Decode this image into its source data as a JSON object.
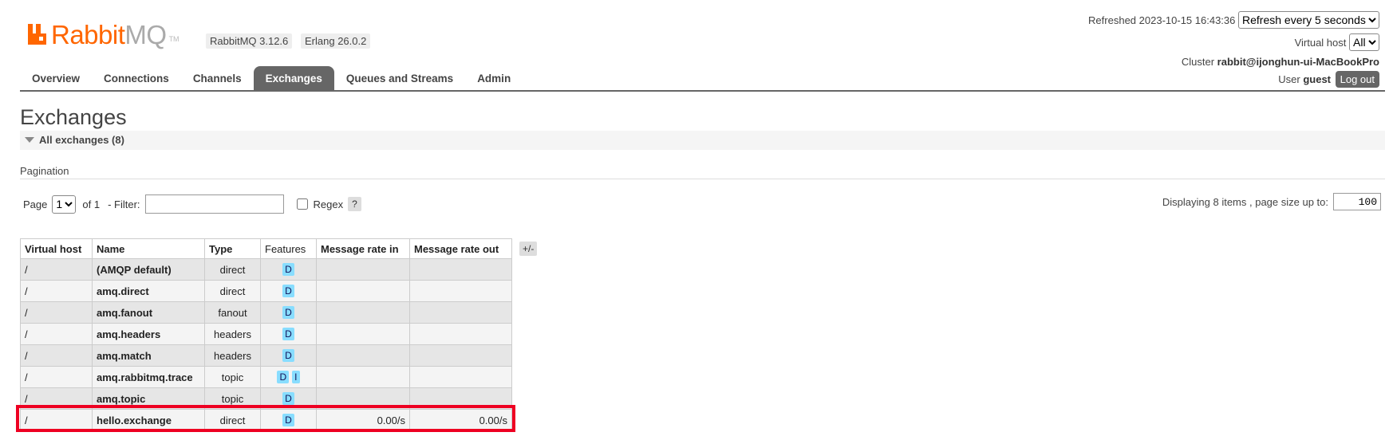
{
  "header": {
    "logo_rabbit": "Rabbit",
    "logo_mq": "MQ",
    "logo_tm": "TM",
    "rabbitmq_version": "RabbitMQ 3.12.6",
    "erlang_version": "Erlang 26.0.2",
    "refreshed_label": "Refreshed",
    "refreshed_time": "2023-10-15 16:43:36",
    "refresh_selected": "Refresh every 5 seconds",
    "vhost_label": "Virtual host",
    "vhost_selected": "All",
    "cluster_label": "Cluster",
    "cluster_name": "rabbit@ijonghun-ui-MacBookPro",
    "user_label": "User",
    "user_name": "guest",
    "logout_label": "Log out"
  },
  "tabs": [
    {
      "label": "Overview"
    },
    {
      "label": "Connections"
    },
    {
      "label": "Channels"
    },
    {
      "label": "Exchanges"
    },
    {
      "label": "Queues and Streams"
    },
    {
      "label": "Admin"
    }
  ],
  "page": {
    "title": "Exchanges",
    "section_title": "All exchanges (8)",
    "pagination_label": "Pagination",
    "page_label": "Page",
    "page_selected": "1",
    "of_label": "of 1",
    "filter_label": "- Filter:",
    "filter_value": "",
    "regex_label": "Regex",
    "help_label": "?",
    "display_label": "Displaying 8 items , page size up to:",
    "page_size": "100"
  },
  "table": {
    "columns": [
      "Virtual host",
      "Name",
      "Type",
      "Features",
      "Message rate in",
      "Message rate out"
    ],
    "toggle_label": "+/-",
    "rows": [
      {
        "vhost": "/",
        "name": "(AMQP default)",
        "type": "direct",
        "features": [
          "D"
        ],
        "rate_in": "",
        "rate_out": ""
      },
      {
        "vhost": "/",
        "name": "amq.direct",
        "type": "direct",
        "features": [
          "D"
        ],
        "rate_in": "",
        "rate_out": ""
      },
      {
        "vhost": "/",
        "name": "amq.fanout",
        "type": "fanout",
        "features": [
          "D"
        ],
        "rate_in": "",
        "rate_out": ""
      },
      {
        "vhost": "/",
        "name": "amq.headers",
        "type": "headers",
        "features": [
          "D"
        ],
        "rate_in": "",
        "rate_out": ""
      },
      {
        "vhost": "/",
        "name": "amq.match",
        "type": "headers",
        "features": [
          "D"
        ],
        "rate_in": "",
        "rate_out": ""
      },
      {
        "vhost": "/",
        "name": "amq.rabbitmq.trace",
        "type": "topic",
        "features": [
          "D",
          "I"
        ],
        "rate_in": "",
        "rate_out": ""
      },
      {
        "vhost": "/",
        "name": "amq.topic",
        "type": "topic",
        "features": [
          "D"
        ],
        "rate_in": "",
        "rate_out": ""
      },
      {
        "vhost": "/",
        "name": "hello.exchange",
        "type": "direct",
        "features": [
          "D"
        ],
        "rate_in": "0.00/s",
        "rate_out": "0.00/s"
      }
    ]
  },
  "colors": {
    "brand_orange": "#ff6600",
    "tab_active": "#666666",
    "badge": "#88ddff",
    "highlight": "#ee0022"
  }
}
